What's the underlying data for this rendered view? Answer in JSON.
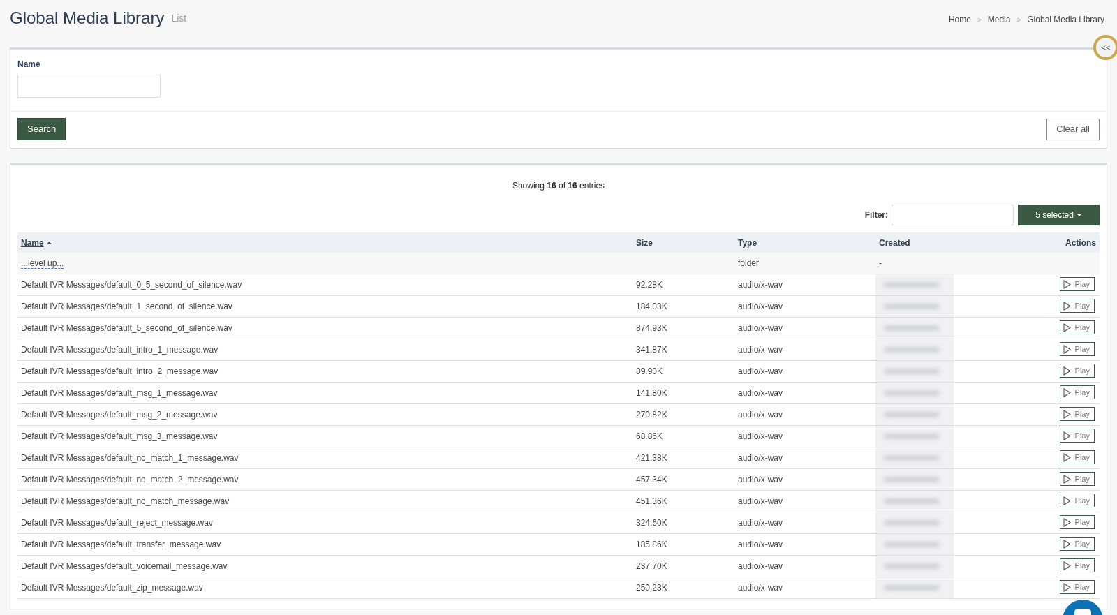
{
  "header": {
    "title": "Global Media Library",
    "subtitle": "List",
    "breadcrumb": [
      "Home",
      "Media",
      "Global Media Library"
    ],
    "breadcrumb_separator": ">"
  },
  "collapse_button": {
    "label": "<<"
  },
  "search_panel": {
    "field_label": "Name",
    "search_button": "Search",
    "clear_button": "Clear all"
  },
  "list_panel": {
    "summary": "Showing **16** of **16** entries",
    "filter_label": "Filter:",
    "columns_button": "5 selected",
    "table": {
      "columns": [
        {
          "label": "Name",
          "sorted": true
        },
        {
          "label": "Size",
          "sorted": false
        },
        {
          "label": "Type",
          "sorted": false
        },
        {
          "label": "Created",
          "sorted": false
        },
        {
          "label": "Actions",
          "sorted": false
        }
      ],
      "rows": [
        {
          "kind": "parent",
          "name": "...level up...",
          "type": "folder",
          "created": "-"
        },
        {
          "kind": "file",
          "name": "Default IVR Messages/default_0_5_second_of_silence.wav",
          "size": "92.28K",
          "type": "audio/x-wav",
          "action": "Play"
        },
        {
          "kind": "file",
          "name": "Default IVR Messages/default_1_second_of_silence.wav",
          "size": "184.03K",
          "type": "audio/x-wav",
          "action": "Play"
        },
        {
          "kind": "file",
          "name": "Default IVR Messages/default_5_second_of_silence.wav",
          "size": "874.93K",
          "type": "audio/x-wav",
          "action": "Play"
        },
        {
          "kind": "file",
          "name": "Default IVR Messages/default_intro_1_message.wav",
          "size": "341.87K",
          "type": "audio/x-wav",
          "action": "Play"
        },
        {
          "kind": "file",
          "name": "Default IVR Messages/default_intro_2_message.wav",
          "size": "89.90K",
          "type": "audio/x-wav",
          "action": "Play"
        },
        {
          "kind": "file",
          "name": "Default IVR Messages/default_msg_1_message.wav",
          "size": "141.80K",
          "type": "audio/x-wav",
          "action": "Play"
        },
        {
          "kind": "file",
          "name": "Default IVR Messages/default_msg_2_message.wav",
          "size": "270.82K",
          "type": "audio/x-wav",
          "action": "Play"
        },
        {
          "kind": "file",
          "name": "Default IVR Messages/default_msg_3_message.wav",
          "size": "68.86K",
          "type": "audio/x-wav",
          "action": "Play"
        },
        {
          "kind": "file",
          "name": "Default IVR Messages/default_no_match_1_message.wav",
          "size": "421.38K",
          "type": "audio/x-wav",
          "action": "Play"
        },
        {
          "kind": "file",
          "name": "Default IVR Messages/default_no_match_2_message.wav",
          "size": "457.34K",
          "type": "audio/x-wav",
          "action": "Play"
        },
        {
          "kind": "file",
          "name": "Default IVR Messages/default_no_match_message.wav",
          "size": "451.36K",
          "type": "audio/x-wav",
          "action": "Play"
        },
        {
          "kind": "file",
          "name": "Default IVR Messages/default_reject_message.wav",
          "size": "324.60K",
          "type": "audio/x-wav",
          "action": "Play"
        },
        {
          "kind": "file",
          "name": "Default IVR Messages/default_transfer_message.wav",
          "size": "185.86K",
          "type": "audio/x-wav",
          "action": "Play"
        },
        {
          "kind": "file",
          "name": "Default IVR Messages/default_voicemail_message.wav",
          "size": "237.70K",
          "type": "audio/x-wav",
          "action": "Play"
        },
        {
          "kind": "file",
          "name": "Default IVR Messages/default_zip_message.wav",
          "size": "250.23K",
          "type": "audio/x-wav",
          "action": "Play"
        }
      ]
    }
  }
}
